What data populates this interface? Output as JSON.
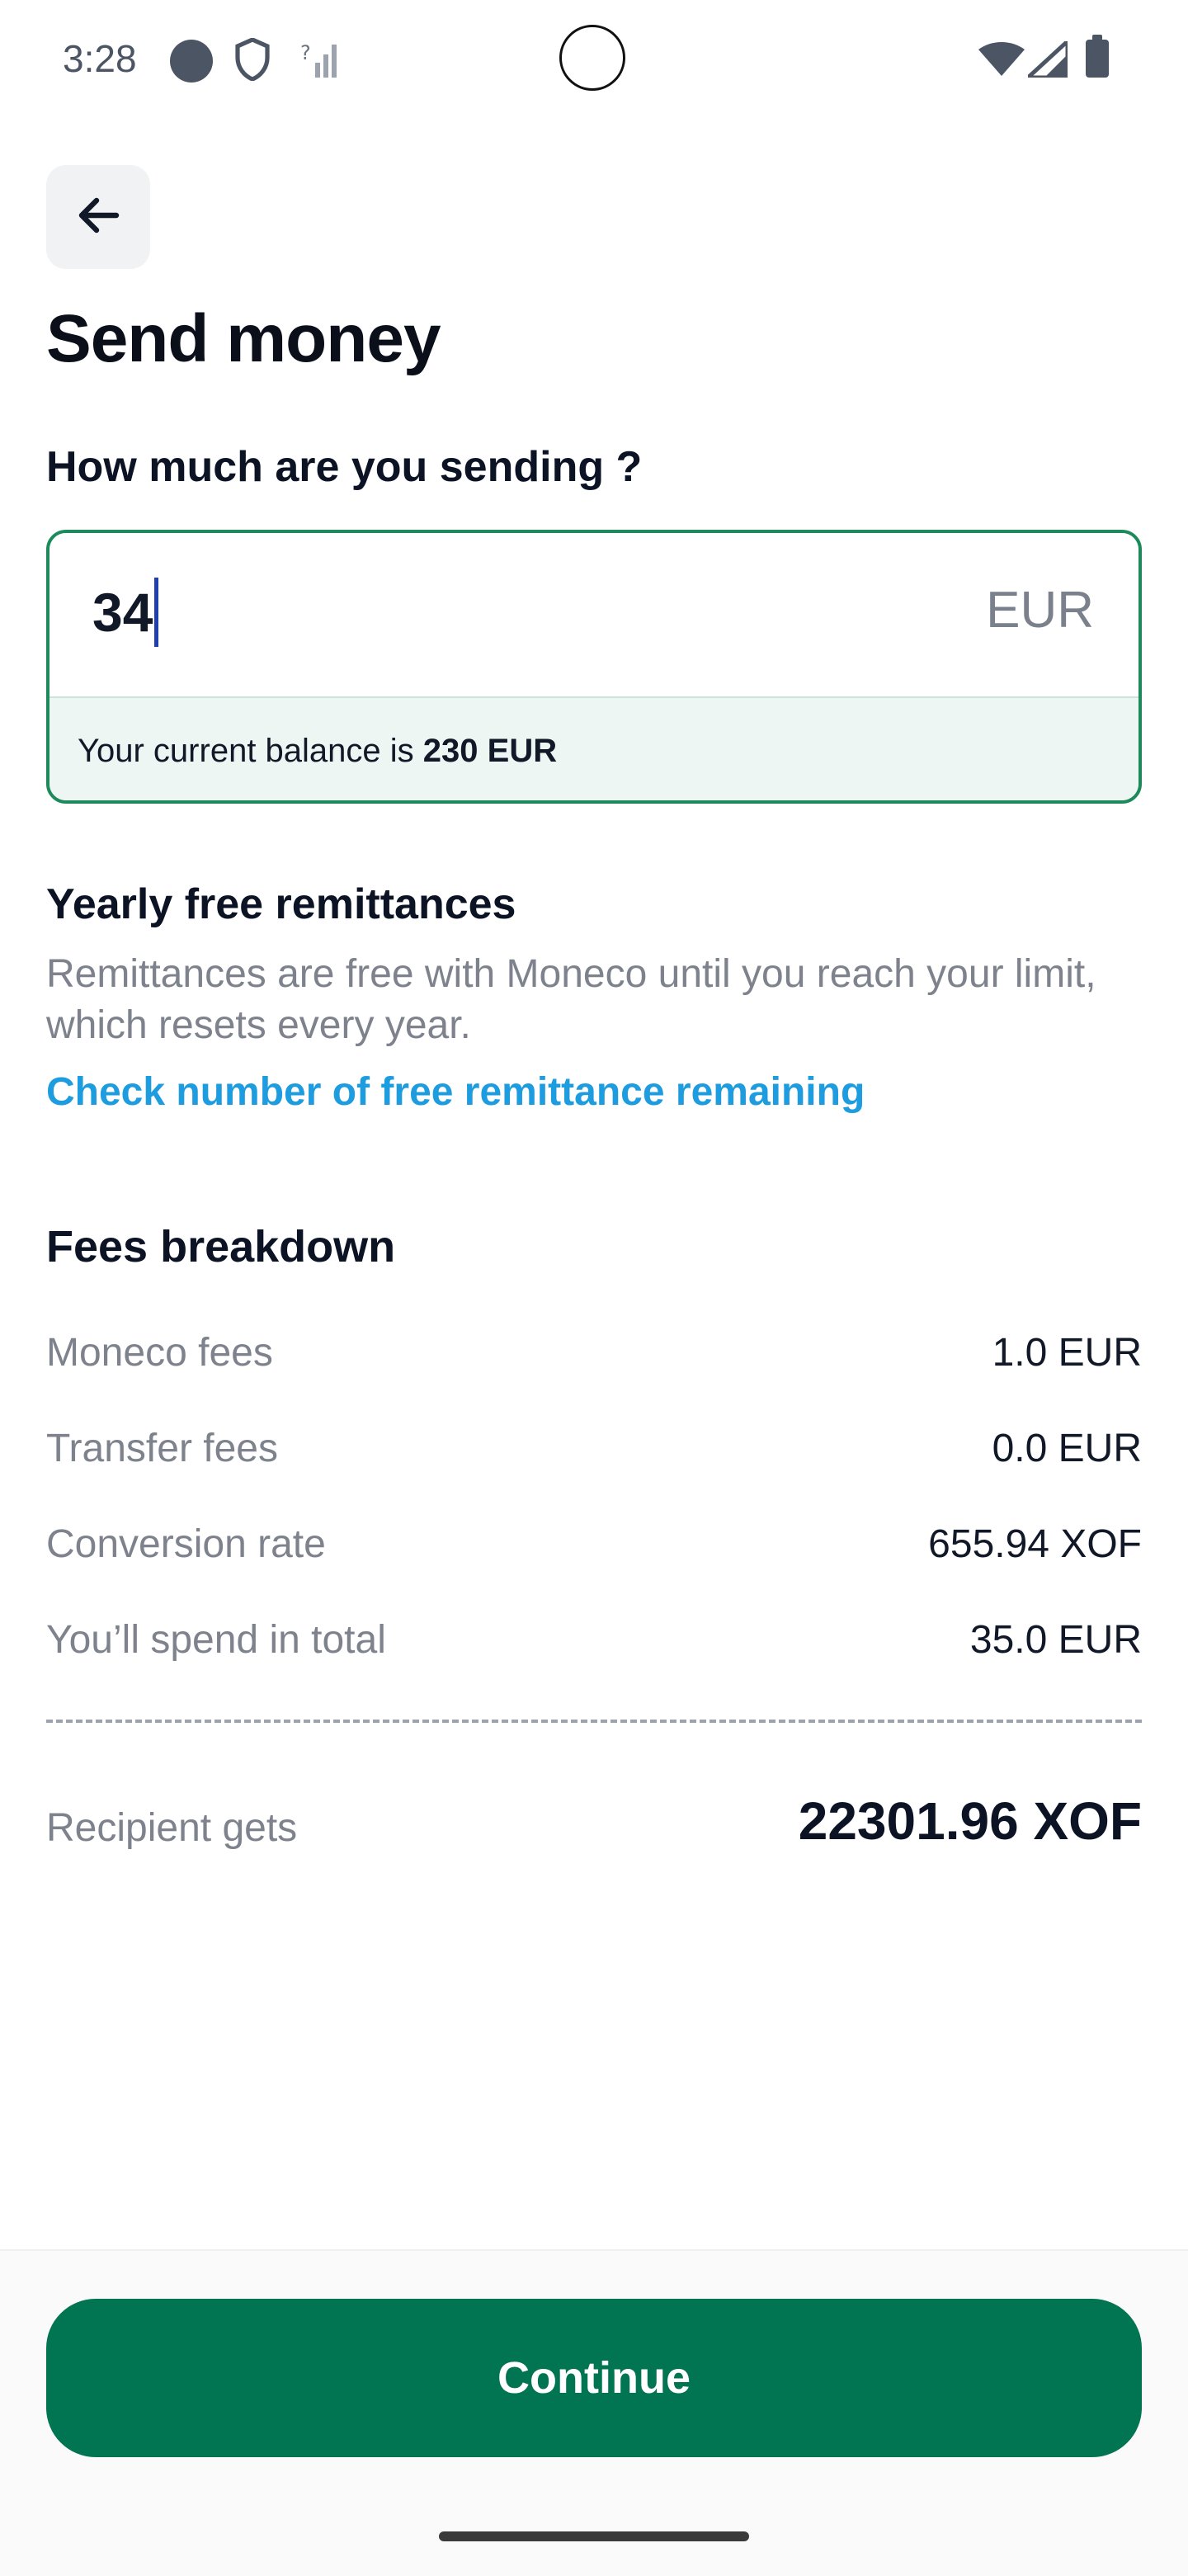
{
  "status_bar": {
    "time": "3:28",
    "icons": [
      "notification-dot-icon",
      "shield-icon",
      "no-signal-icon",
      "wifi-icon",
      "cellular-icon",
      "battery-icon"
    ]
  },
  "header": {
    "back_icon": "arrow-left-icon",
    "title": "Send money"
  },
  "amount": {
    "question": "How much are you sending ?",
    "value": "34",
    "currency": "EUR",
    "balance_prefix": "Your current balance is ",
    "balance_value": "230 EUR"
  },
  "yearly": {
    "title": "Yearly free remittances",
    "description": "Remittances are free with Moneco until you reach your limit, which resets every year.",
    "link": "Check number of free remittance remaining"
  },
  "fees": {
    "title": "Fees breakdown",
    "rows": [
      {
        "label": "Moneco fees",
        "value": "1.0 EUR"
      },
      {
        "label": "Transfer fees",
        "value": "0.0 EUR"
      },
      {
        "label": "Conversion rate",
        "value": "655.94 XOF"
      },
      {
        "label": "You’ll spend in total",
        "value": "35.0 EUR"
      }
    ],
    "recipient_label": "Recipient gets",
    "recipient_value": "22301.96 XOF"
  },
  "footer": {
    "continue_label": "Continue"
  },
  "colors": {
    "accent_green": "#017452",
    "border_green": "#1d8a5d",
    "link_blue": "#1e9ce0"
  }
}
